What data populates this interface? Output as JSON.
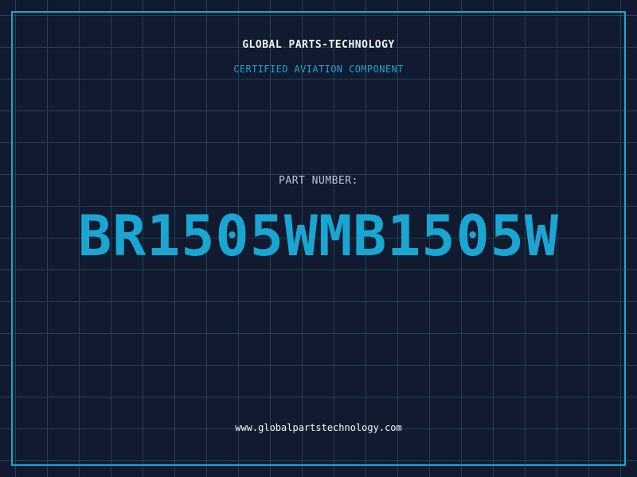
{
  "header": {
    "brand": "GLOBAL PARTS-TECHNOLOGY",
    "subtitle": "CERTIFIED AVIATION COMPONENT"
  },
  "main": {
    "label": "PART NUMBER:",
    "part_number": "BR1505WMB1505W"
  },
  "footer": {
    "url": "www.globalpartstechnology.com"
  },
  "colors": {
    "background": "#111a2e",
    "grid": "#1d4a5f",
    "accent": "#1aa6d2",
    "text": "#f2f4f8",
    "muted": "#b8c4d4"
  }
}
